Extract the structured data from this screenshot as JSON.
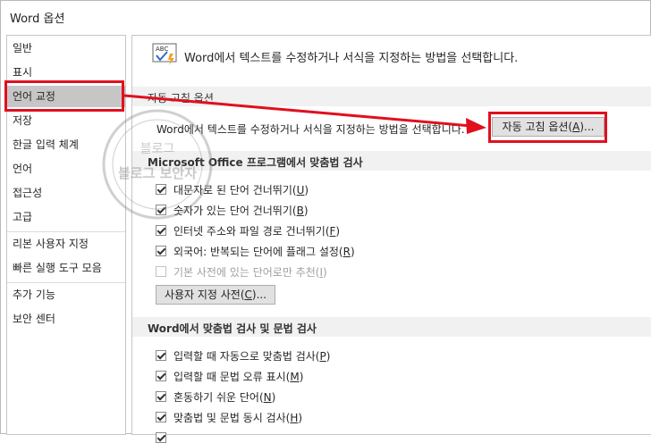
{
  "window": {
    "title": "Word 옵션"
  },
  "sidebar": {
    "items": [
      {
        "label": "일반"
      },
      {
        "label": "표시"
      },
      {
        "label": "언어 교정"
      },
      {
        "label": "저장"
      },
      {
        "label": "한글 입력 체계"
      },
      {
        "label": "언어"
      },
      {
        "label": "접근성"
      },
      {
        "label": "고급"
      },
      {
        "label": "리본 사용자 지정"
      },
      {
        "label": "빠른 실행 도구 모음"
      },
      {
        "label": "추가 기능"
      },
      {
        "label": "보안 센터"
      }
    ]
  },
  "header": {
    "description": "Word에서 텍스트를 수정하거나 서식을 지정하는 방법을 선택합니다."
  },
  "autocorrect": {
    "title": "자동 고침 옵션",
    "description": "Word에서 텍스트를 수정하거나 서식을 지정하는 방법을 선택합니다.",
    "button_label": "자동 고침 옵션(",
    "button_key": "A",
    "button_suffix": ")..."
  },
  "office_spelling": {
    "title": "Microsoft Office 프로그램에서 맞춤법 검사",
    "options": [
      {
        "label": "대문자로 된 단어 건너뛰기(",
        "key": "U",
        "suffix": ")",
        "checked": true
      },
      {
        "label": "숫자가 있는 단어 건너뛰기(",
        "key": "B",
        "suffix": ")",
        "checked": true
      },
      {
        "label": "인터넷 주소와 파일 경로 건너뛰기(",
        "key": "F",
        "suffix": ")",
        "checked": true
      },
      {
        "label": "외국어: 반복되는 단어에 플래그 설정(",
        "key": "R",
        "suffix": ")",
        "checked": true
      },
      {
        "label": "기본 사전에 있는 단어로만 추천(",
        "key": "I",
        "suffix": ")",
        "checked": false
      }
    ],
    "custom_dict_button": {
      "label": "사용자 지정 사전(",
      "key": "C",
      "suffix": ")..."
    }
  },
  "word_spelling": {
    "title": "Word에서 맞춤법 검사 및 문법 검사",
    "options": [
      {
        "label": "입력할 때 자동으로 맞춤법 검사(",
        "key": "P",
        "suffix": ")",
        "checked": true
      },
      {
        "label": "입력할 때 문법 오류 표시(",
        "key": "M",
        "suffix": ")",
        "checked": true
      },
      {
        "label": "혼동하기 쉬운 단어(",
        "key": "N",
        "suffix": ")",
        "checked": true
      },
      {
        "label": "맞춤법 및 문법 동시 검사(",
        "key": "H",
        "suffix": ")",
        "checked": true
      }
    ]
  },
  "colors": {
    "highlight_red": "#e0101e",
    "selected_bg": "#c6c6c6",
    "section_bg": "#f1f1f1"
  },
  "watermark": {
    "top": "블로그",
    "middle": "블로그 보안자"
  }
}
